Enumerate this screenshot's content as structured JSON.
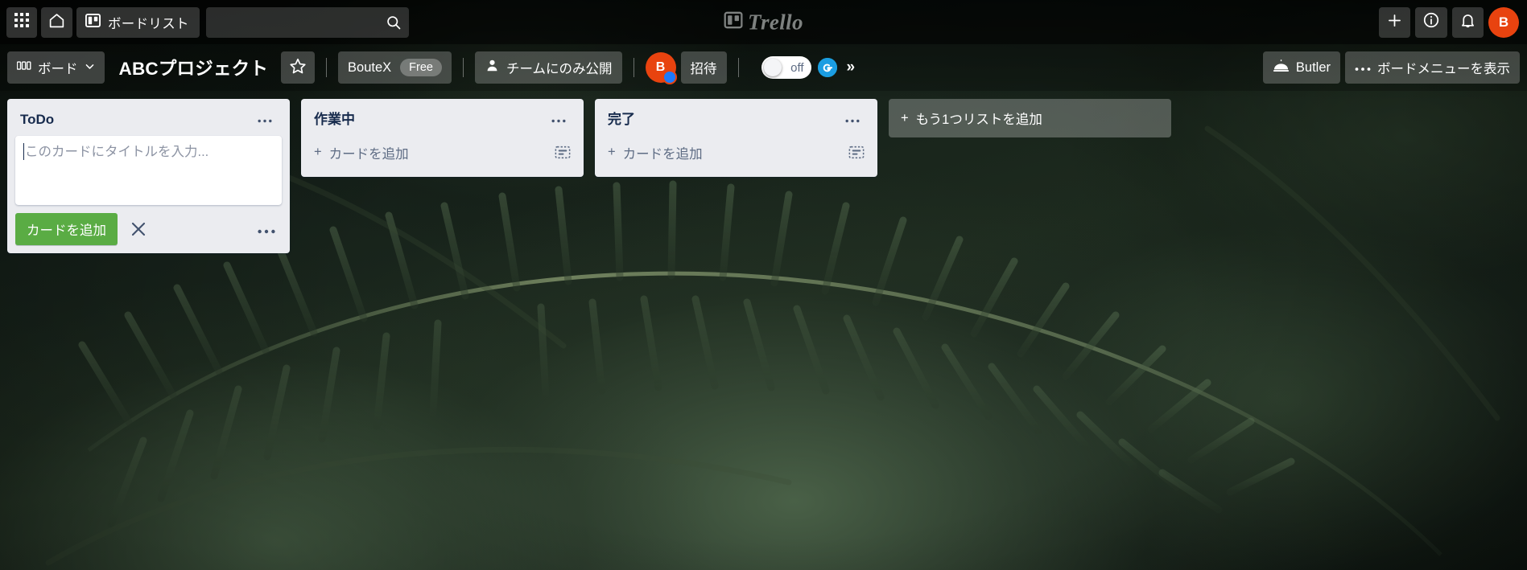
{
  "top_nav": {
    "apps_button": {
      "name": "apps-grid",
      "label": ""
    },
    "home_button": {
      "label": ""
    },
    "boards_button": {
      "label": "ボードリスト"
    },
    "search": {
      "value": "",
      "placeholder": ""
    },
    "brand": {
      "word": "Trello"
    },
    "add_button": {
      "label": ""
    },
    "info_button": {
      "label": ""
    },
    "notifications_button": {
      "label": ""
    },
    "avatar": {
      "initial": "B"
    }
  },
  "board_bar": {
    "boards_menu": {
      "label": "ボード"
    },
    "title": "ABCプロジェクト",
    "star": {
      "label": ""
    },
    "workspace": {
      "name": "BouteX",
      "plan": "Free"
    },
    "visibility": {
      "label": "チームにのみ公開"
    },
    "member": {
      "initial": "B"
    },
    "invite": {
      "label": "招待"
    },
    "toggle": {
      "state": "off"
    },
    "grammarly": {
      "letter": "G"
    },
    "more_chevron": "»",
    "butler": {
      "label": "Butler"
    },
    "board_menu": {
      "label": "ボードメニューを表示"
    }
  },
  "lists": [
    {
      "title": "ToDo",
      "composer": {
        "placeholder": "このカードにタイトルを入力...",
        "value": "",
        "submit_label": "カードを追加",
        "cancel_label": "×",
        "more_label": "•••"
      },
      "menu_label": "•••"
    },
    {
      "title": "作業中",
      "add_card_label": "カードを追加",
      "add_card_plus": "+",
      "menu_label": "•••"
    },
    {
      "title": "完了",
      "add_card_label": "カードを追加",
      "add_card_plus": "+",
      "menu_label": "•••"
    }
  ],
  "add_list": {
    "plus": "+",
    "label": "もう1つリストを追加"
  },
  "colors": {
    "list_background": "#ebecf0",
    "add_card_button": "#5aac44",
    "avatar": "#e8430f",
    "title_text": "#172b4d"
  }
}
